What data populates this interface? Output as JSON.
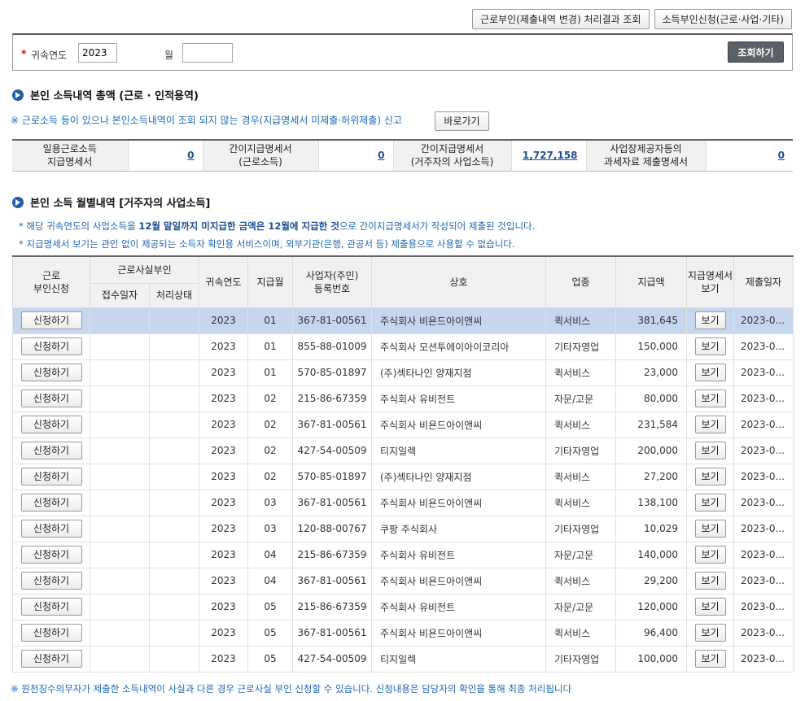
{
  "top_buttons": {
    "result_label": "근로부인(제출내역 변경) 처리결과 조회",
    "apply_label": "소득부인신청(근로·사업·기타)"
  },
  "search": {
    "required_mark": "*",
    "year_label": "귀속연도",
    "year_value": "2023",
    "month_label": "월",
    "month_value": "",
    "submit_label": "조회하기"
  },
  "section1": {
    "title": "본인 소득내역 총액  (근로 · 인적용역)",
    "notice": "※ 근로소득 등이 있으나 본인소득내역이 조회 되지 않는 경우(지급명세서 미제출·허위제출) 신고",
    "goto_label": "바로가기",
    "summary": [
      {
        "label": "일용근로소득\n지급명세서",
        "value": "0"
      },
      {
        "label": "간이지급명세서\n(근로소득)",
        "value": "0"
      },
      {
        "label": "간이지급명세서\n(거주자의 사업소득)",
        "value": "1,727,158"
      },
      {
        "label": "사업장제공자등의\n과세자료 제출명세서",
        "value": "0"
      }
    ]
  },
  "section2": {
    "title": "본인 소득 월별내역 [거주자의 사업소득]",
    "notice1_pre": "* 해당 귀속연도의 사업소득을 ",
    "notice1_bold": "12월 말일까지 미지급한 금액은 12월에 지급한 것",
    "notice1_post": "으로 간이지급명세서가 작성되어 제출된 것입니다.",
    "notice2": "* 지급명세서 보기는 관인 없이 제공되는 소득자 확인용 서비스이며, 외부기관(은행, 관공서 등) 제출용으로 사용할 수 없습니다."
  },
  "table": {
    "headers": {
      "apply": "근로\n부인신청",
      "fact": "근로사실부인",
      "received": "접수일자",
      "status": "처리상태",
      "year": "귀속연도",
      "month": "지급월",
      "bizno": "사업자(주민)\n등록번호",
      "company": "상호",
      "industry": "업종",
      "amount": "지급액",
      "view": "지급명세서\n보기",
      "submitted": "제출일자"
    },
    "apply_label": "신청하기",
    "view_label": "보기",
    "rows": [
      {
        "year": "2023",
        "month": "01",
        "bizno": "367-81-00561",
        "company": "주식회사 비욘드아이앤씨",
        "industry": "퀵서비스",
        "amount": "381,645",
        "submitted": "2023-0..."
      },
      {
        "year": "2023",
        "month": "01",
        "bizno": "855-88-01009",
        "company": "주식회사 모션투에이아이코리아",
        "industry": "기타자영업",
        "amount": "150,000",
        "submitted": "2023-0..."
      },
      {
        "year": "2023",
        "month": "01",
        "bizno": "570-85-01897",
        "company": "(주)섹타나인 양재지점",
        "industry": "퀵서비스",
        "amount": "23,000",
        "submitted": "2023-0..."
      },
      {
        "year": "2023",
        "month": "02",
        "bizno": "215-86-67359",
        "company": "주식회사 유비전트",
        "industry": "자문/고문",
        "amount": "80,000",
        "submitted": "2023-0..."
      },
      {
        "year": "2023",
        "month": "02",
        "bizno": "367-81-00561",
        "company": "주식회사 비욘드아이앤씨",
        "industry": "퀵서비스",
        "amount": "231,584",
        "submitted": "2023-0..."
      },
      {
        "year": "2023",
        "month": "02",
        "bizno": "427-54-00509",
        "company": "티지일렉",
        "industry": "기타자영업",
        "amount": "200,000",
        "submitted": "2023-0..."
      },
      {
        "year": "2023",
        "month": "02",
        "bizno": "570-85-01897",
        "company": "(주)섹타나인 양재지점",
        "industry": "퀵서비스",
        "amount": "27,200",
        "submitted": "2023-0..."
      },
      {
        "year": "2023",
        "month": "03",
        "bizno": "367-81-00561",
        "company": "주식회사 비욘드아이앤씨",
        "industry": "퀵서비스",
        "amount": "138,100",
        "submitted": "2023-0..."
      },
      {
        "year": "2023",
        "month": "03",
        "bizno": "120-88-00767",
        "company": "쿠팡 주식회사",
        "industry": "기타자영업",
        "amount": "10,029",
        "submitted": "2023-0..."
      },
      {
        "year": "2023",
        "month": "04",
        "bizno": "215-86-67359",
        "company": "주식회사 유비전트",
        "industry": "자문/고문",
        "amount": "140,000",
        "submitted": "2023-0..."
      },
      {
        "year": "2023",
        "month": "04",
        "bizno": "367-81-00561",
        "company": "주식회사 비욘드아이앤씨",
        "industry": "퀵서비스",
        "amount": "29,200",
        "submitted": "2023-0..."
      },
      {
        "year": "2023",
        "month": "05",
        "bizno": "215-86-67359",
        "company": "주식회사 유비전트",
        "industry": "자문/고문",
        "amount": "120,000",
        "submitted": "2023-0..."
      },
      {
        "year": "2023",
        "month": "05",
        "bizno": "367-81-00561",
        "company": "주식회사 비욘드아이앤씨",
        "industry": "퀵서비스",
        "amount": "96,400",
        "submitted": "2023-0..."
      },
      {
        "year": "2023",
        "month": "05",
        "bizno": "427-54-00509",
        "company": "티지일렉",
        "industry": "기타자영업",
        "amount": "100,000",
        "submitted": "2023-0..."
      }
    ]
  },
  "bottom_note": "※ 원천징수의무자가 제출한 소득내역이 사실과 다른 경우 근로사실 부인 신청할 수 있습니다. 신청내용은 담당자의 확인을 통해 최종 처리됩니다",
  "colors": {
    "accent": "#1f5fa8",
    "notice": "#2068b1",
    "selected_row": "#c6d6ee"
  }
}
